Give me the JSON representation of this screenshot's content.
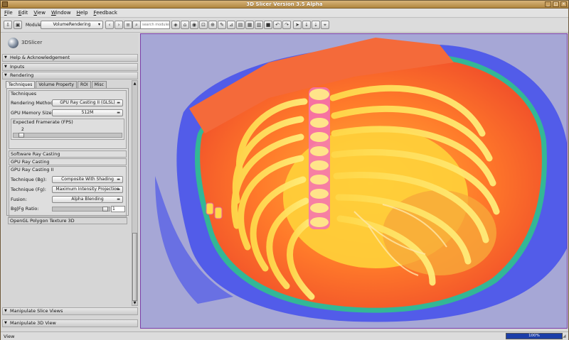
{
  "window": {
    "title": "3D Slicer Version 3.5 Alpha"
  },
  "menu": [
    "File",
    "Edit",
    "View",
    "Window",
    "Help",
    "Feedback"
  ],
  "toolbar": {
    "modules_label": "Modules:",
    "module_selected": "VolumeRendering",
    "search_placeholder": "search modules"
  },
  "logo": {
    "text": "3DSlicer"
  },
  "sections": {
    "help": "Help & Acknowledgement",
    "inputs": "Inputs",
    "rendering": "Rendering",
    "manipulate_slice": "Manipulate Slice Views",
    "manipulate_3d": "Manipulate 3D View"
  },
  "tabs": [
    "Techniques",
    "Volume Property",
    "ROI",
    "Misc"
  ],
  "techniques": {
    "group_title": "Techniques",
    "rendering_method_label": "Rendering Method",
    "rendering_method_value": "GPU Ray Casting II (GLSL)",
    "gpu_memory_label": "GPU Memory Size",
    "gpu_memory_value": "512M",
    "framerate_title": "Expected Framerate (FPS)",
    "framerate_value": "2",
    "framerate_fraction": 0.05
  },
  "subsections": {
    "software_ray": "Software Ray Casting",
    "gpu_ray": "GPU Ray Casting",
    "gpu_ray_ii": "GPU Ray Casting II",
    "opengl": "OpenGL Polygon Texture 3D"
  },
  "gpu2": {
    "technique_bg_label": "Technique (Bg):",
    "technique_bg_value": "Composite With Shading",
    "technique_fg_label": "Technique (Fg):",
    "technique_fg_value": "Maximum Intensity Projection",
    "fusion_label": "Fusion:",
    "fusion_value": "Alpha Blending",
    "ratio_label": "Bg|Fg Ratio:",
    "ratio_value": "1",
    "ratio_fraction": 0.97
  },
  "status": {
    "text": "View",
    "progress": "100%"
  },
  "colors": {
    "title_bar": "#c09650",
    "viewer_bg": "#a6a7d6",
    "progress": "#1c3ea8"
  }
}
